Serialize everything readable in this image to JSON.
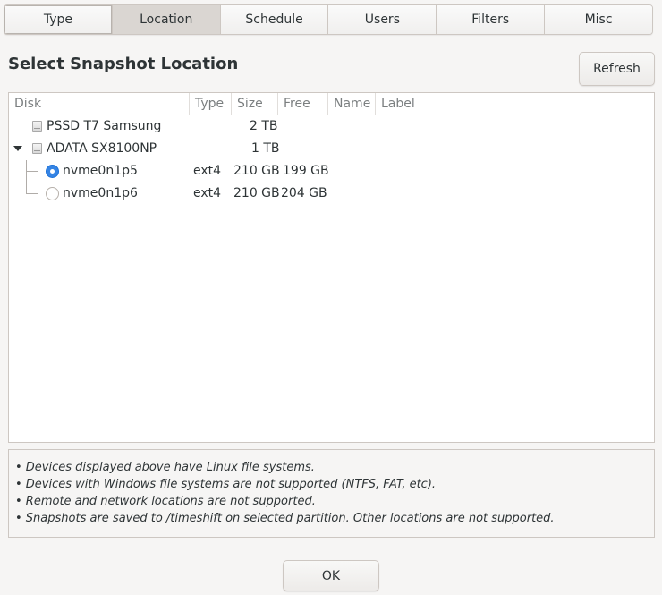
{
  "tabs": [
    {
      "label": "Type",
      "active": false
    },
    {
      "label": "Location",
      "active": true
    },
    {
      "label": "Schedule",
      "active": false
    },
    {
      "label": "Users",
      "active": false
    },
    {
      "label": "Filters",
      "active": false
    },
    {
      "label": "Misc",
      "active": false
    }
  ],
  "header": {
    "title": "Select Snapshot Location",
    "refresh_label": "Refresh"
  },
  "table": {
    "columns": [
      "Disk",
      "Type",
      "Size",
      "Free",
      "Name",
      "Label"
    ],
    "rows": [
      {
        "disk": "PSSD T7 Samsung",
        "type": "",
        "size": "2 TB",
        "free": "",
        "name": "",
        "label": "",
        "kind": "disk",
        "expanded": false
      },
      {
        "disk": "ADATA SX8100NP",
        "type": "",
        "size": "1 TB",
        "free": "",
        "name": "",
        "label": "",
        "kind": "disk",
        "expanded": true
      },
      {
        "disk": "nvme0n1p5",
        "type": "ext4",
        "size": "210 GB",
        "free": "199 GB",
        "name": "",
        "label": "",
        "kind": "partition",
        "selected": true
      },
      {
        "disk": "nvme0n1p6",
        "type": "ext4",
        "size": "210 GB",
        "free": "204 GB",
        "name": "",
        "label": "",
        "kind": "partition",
        "selected": false
      }
    ]
  },
  "notes": [
    "• Devices displayed above have Linux file systems.",
    "• Devices with Windows file systems are not supported (NTFS, FAT, etc).",
    "• Remote and network locations are not supported.",
    "• Snapshots are saved to /timeshift on selected partition. Other locations are not supported."
  ],
  "footer": {
    "ok_label": "OK"
  },
  "colors": {
    "accent": "#3584e4",
    "active_tab": "#dad6d2",
    "background": "#f6f5f4"
  }
}
